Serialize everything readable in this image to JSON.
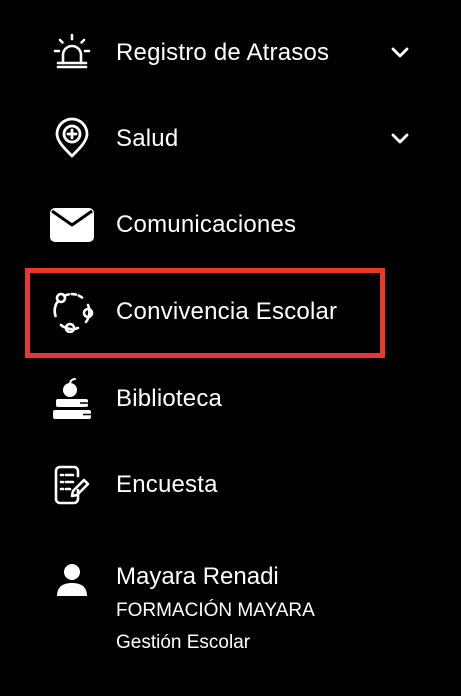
{
  "menu": {
    "items": [
      {
        "label": "Registro de Atrasos",
        "icon": "alarm-siren-icon",
        "has_chevron": true
      },
      {
        "label": "Salud",
        "icon": "health-location-icon",
        "has_chevron": true
      },
      {
        "label": "Comunicaciones",
        "icon": "envelope-icon",
        "has_chevron": false
      },
      {
        "label": "Convivencia Escolar",
        "icon": "cycle-nodes-icon",
        "has_chevron": false,
        "highlighted": true
      },
      {
        "label": "Biblioteca",
        "icon": "books-apple-icon",
        "has_chevron": false
      },
      {
        "label": "Encuesta",
        "icon": "survey-edit-icon",
        "has_chevron": false
      }
    ]
  },
  "user": {
    "name": "Mayara Renadi",
    "organization": "FORMACIÓN MAYARA",
    "role": "Gestión Escolar",
    "icon": "user-icon"
  },
  "colors": {
    "background": "#000000",
    "text": "#ffffff",
    "highlight": "#e8392a"
  }
}
